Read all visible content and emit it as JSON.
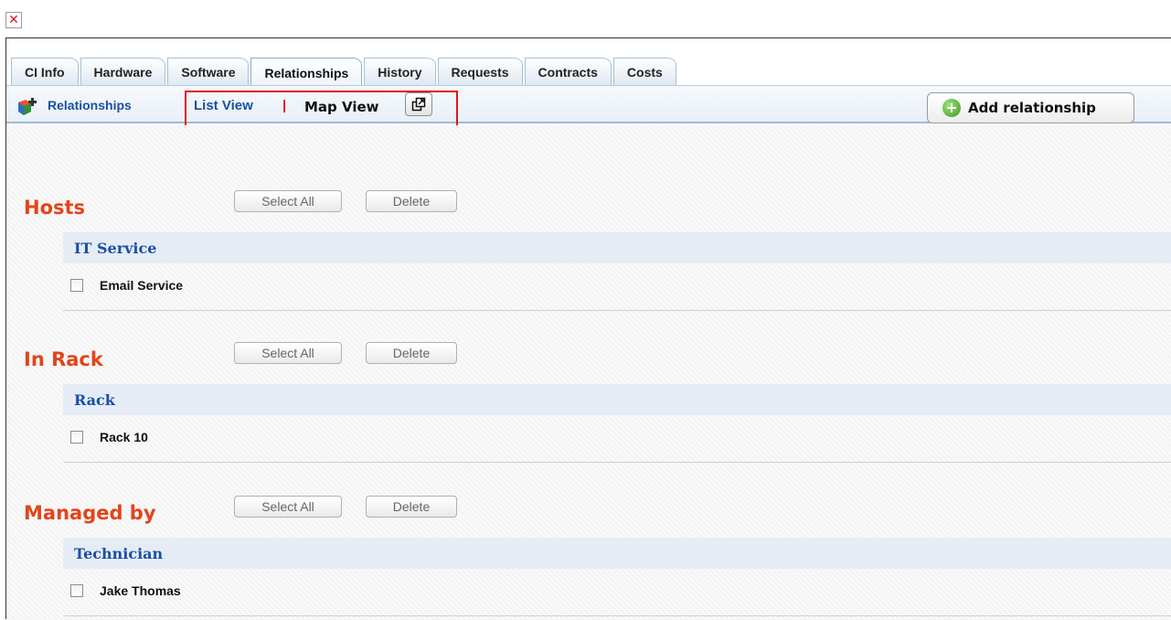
{
  "tabs": [
    {
      "label": "CI Info"
    },
    {
      "label": "Hardware"
    },
    {
      "label": "Software"
    },
    {
      "label": "Relationships"
    },
    {
      "label": "History"
    },
    {
      "label": "Requests"
    },
    {
      "label": "Contracts"
    },
    {
      "label": "Costs"
    }
  ],
  "active_tab": "Relationships",
  "subbar": {
    "relationships_link": "Relationships",
    "list_view": "List View",
    "separator": "|",
    "map_view": "Map View",
    "add_relationship": "Add relationship"
  },
  "sections": [
    {
      "title": "Hosts",
      "select_all": "Select All",
      "delete": "Delete",
      "category": "IT Service",
      "items": [
        "Email Service"
      ]
    },
    {
      "title": "In Rack",
      "select_all": "Select All",
      "delete": "Delete",
      "category": "Rack",
      "items": [
        "Rack 10"
      ]
    },
    {
      "title": "Managed by",
      "select_all": "Select All",
      "delete": "Delete",
      "category": "Technician",
      "items": [
        "Jake Thomas"
      ]
    }
  ],
  "colors": {
    "section_title": "#e2451c",
    "link_blue": "#1a4fa3",
    "highlight_box": "#e0161c"
  }
}
